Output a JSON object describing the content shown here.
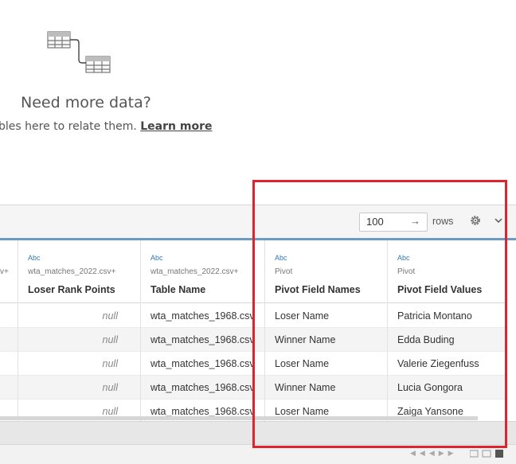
{
  "canvas": {
    "title": "Need more data?",
    "subtitle": "bles here to relate them.",
    "learn_more": "Learn more"
  },
  "toolbar": {
    "rows_value": "100",
    "rows_label": "rows"
  },
  "columns": [
    {
      "type": "",
      "source": "v+",
      "name": ""
    },
    {
      "type": "Abc",
      "source": "wta_matches_2022.csv+",
      "name": "Loser Rank Points"
    },
    {
      "type": "Abc",
      "source": "wta_matches_2022.csv+",
      "name": "Table Name"
    },
    {
      "type": "Abc",
      "source": "Pivot",
      "name": "Pivot Field Names"
    },
    {
      "type": "Abc",
      "source": "Pivot",
      "name": "Pivot Field Values"
    }
  ],
  "rows": [
    [
      "",
      "null",
      "wta_matches_1968.csv",
      "Loser Name",
      "Patricia Montano"
    ],
    [
      "",
      "null",
      "wta_matches_1968.csv",
      "Winner Name",
      "Edda Buding"
    ],
    [
      "",
      "null",
      "wta_matches_1968.csv",
      "Loser Name",
      "Valerie Ziegenfuss"
    ],
    [
      "",
      "null",
      "wta_matches_1968.csv",
      "Winner Name",
      "Lucia Gongora"
    ],
    [
      "",
      "null",
      "wta_matches_1968.csv",
      "Loser Name",
      "Zaiga Yansone"
    ]
  ],
  "icons": {
    "tables": "tables-relate-icon",
    "settings": "gear-icon",
    "menu": "chevron-down-icon",
    "rows_arrow": "arrow-right-icon"
  },
  "colors": {
    "highlight": "#e1232b",
    "type_accent": "#2f7ab5",
    "grid_top": "#6b9bc3"
  }
}
